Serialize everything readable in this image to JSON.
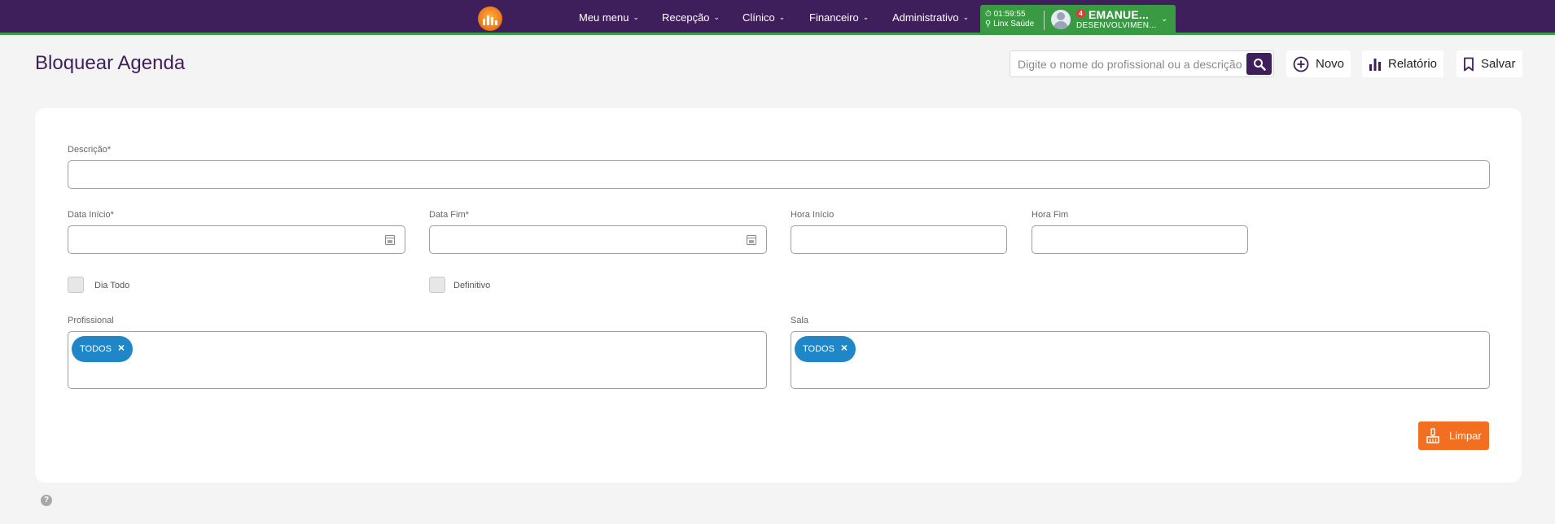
{
  "nav": {
    "items": [
      {
        "label": "Meu menu"
      },
      {
        "label": "Recepção"
      },
      {
        "label": "Clínico"
      },
      {
        "label": "Financeiro"
      },
      {
        "label": "Administrativo"
      }
    ],
    "timer": "01:59:55",
    "location": "Linx Saúde",
    "notification_count": "4",
    "user_name": "EMANUE...",
    "user_role": "DESENVOLVIMEN...",
    "colors": {
      "bar": "#3f1f5b",
      "accent": "#3aa148"
    }
  },
  "header": {
    "title": "Bloquear Agenda",
    "search_placeholder": "Digite o nome do profissional ou a descrição",
    "new_label": "Novo",
    "report_label": "Relatório",
    "save_label": "Salvar"
  },
  "form": {
    "description_label": "Descrição*",
    "description_value": "",
    "start_date_label": "Data Início*",
    "end_date_label": "Data Fim*",
    "start_time_label": "Hora Início",
    "end_time_label": "Hora Fim",
    "all_day_label": "Dia Todo",
    "all_day_checked": false,
    "definitive_label": "Definitivo",
    "definitive_checked": false,
    "professional_label": "Profissional",
    "professional_tags": [
      "TODOS"
    ],
    "room_label": "Sala",
    "room_tags": [
      "TODOS"
    ],
    "clear_label": "Limpar"
  },
  "colors": {
    "tag": "#1f87c8",
    "clear_button": "#f26f21"
  },
  "help_icon": "?"
}
